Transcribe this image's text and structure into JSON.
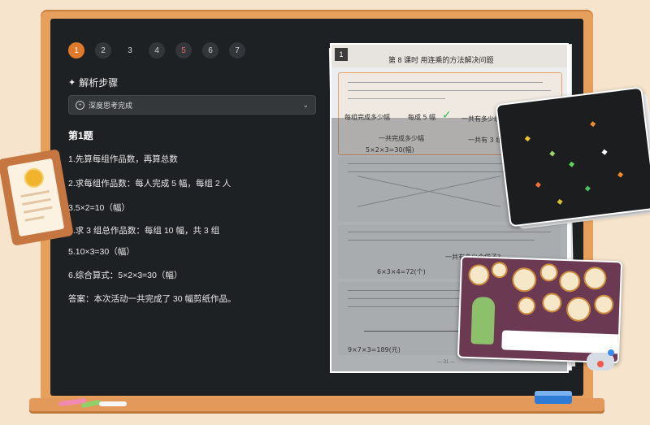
{
  "pagination": {
    "pages": [
      {
        "label": "1",
        "state": "active"
      },
      {
        "label": "2",
        "state": "default"
      },
      {
        "label": "3",
        "state": "plain"
      },
      {
        "label": "4",
        "state": "default"
      },
      {
        "label": "5",
        "state": "red"
      },
      {
        "label": "6",
        "state": "default"
      },
      {
        "label": "7",
        "state": "default"
      }
    ]
  },
  "analysis": {
    "title": "解析步骤",
    "mode_dropdown": "深度思考完成"
  },
  "question": {
    "title": "第1题",
    "steps": [
      "1.先算每组作品数，再算总数",
      "2.求每组作品数：每人完成 5 幅，每组 2 人",
      "3.5×2=10（幅）",
      "4.求 3 组总作品数：每组 10 幅，共 3 组",
      "5.10×3=30（幅）",
      "6.综合算式：5×2×3=30（幅）",
      "答案：本次活动一共完成了 30 幅剪纸作品。"
    ]
  },
  "worksheet": {
    "badge": "1",
    "title": "第 8 课时  用连乘的方法解决问题",
    "handwriting": {
      "box1": "每组完成多少幅",
      "box2": "每成 5 幅",
      "box3": "一共完成多少幅",
      "box4": "一共有多少组",
      "box5": "一共有 3 组",
      "equation1": "5×2×3=30(幅)",
      "equation2": "6×3×4=72(个)",
      "question2": "一共有多少个袋子?",
      "equation3": "9×7×3=189(元)"
    },
    "footer": "— 31 —"
  },
  "colors": {
    "board": "#1e2123",
    "frame": "#e6a05c",
    "accent": "#e07a2a",
    "check": "#2bbf52"
  }
}
